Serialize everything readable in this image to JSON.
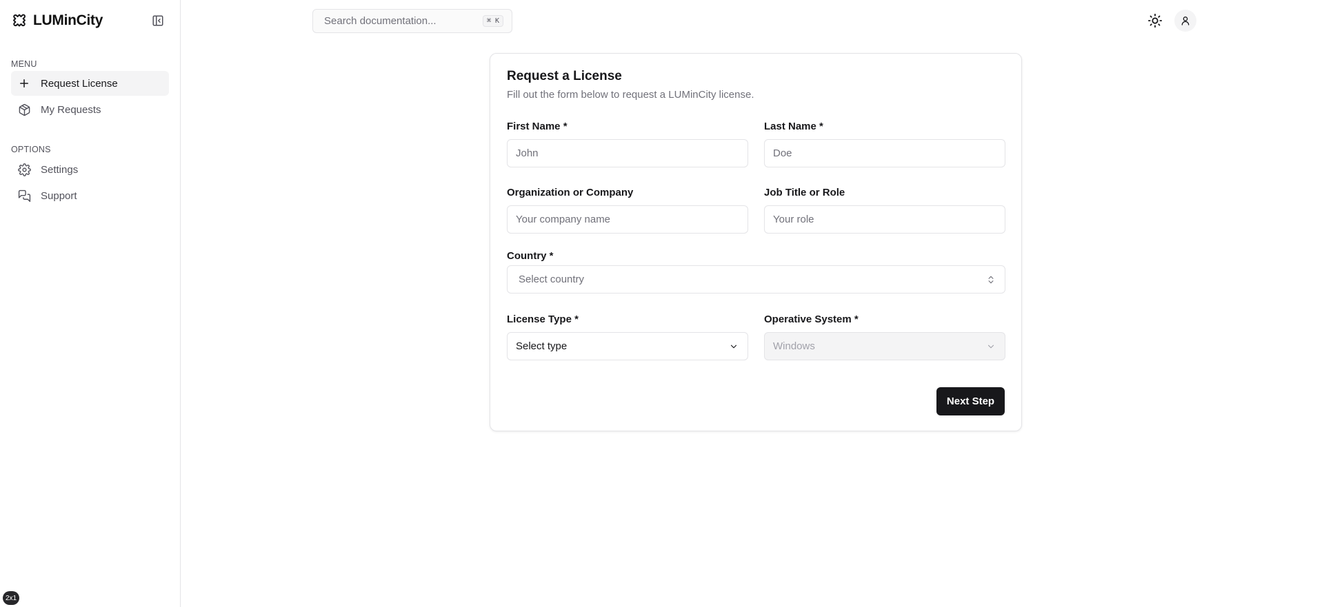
{
  "brand": {
    "name": "LUMinCity"
  },
  "sidebar": {
    "menu_label": "MENU",
    "options_label": "OPTIONS",
    "menu_items": [
      {
        "label": "Request License",
        "icon": "plus-icon",
        "active": true
      },
      {
        "label": "My Requests",
        "icon": "package-icon",
        "active": false
      }
    ],
    "option_items": [
      {
        "label": "Settings",
        "icon": "gear-icon"
      },
      {
        "label": "Support",
        "icon": "chat-bubbles-icon"
      }
    ],
    "badge": "2x1"
  },
  "header": {
    "search_placeholder": "Search documentation...",
    "search_shortcut": "⌘ K"
  },
  "form": {
    "title": "Request a License",
    "subtitle": "Fill out the form below to request a LUMinCity license.",
    "first_name": {
      "label": "First Name *",
      "placeholder": "John",
      "value": ""
    },
    "last_name": {
      "label": "Last Name *",
      "placeholder": "Doe",
      "value": ""
    },
    "organization": {
      "label": "Organization or Company",
      "placeholder": "Your company name",
      "value": ""
    },
    "job_title": {
      "label": "Job Title or Role",
      "placeholder": "Your role",
      "value": ""
    },
    "country": {
      "label": "Country *",
      "value": "Select country"
    },
    "license_type": {
      "label": "License Type *",
      "value": "Select type"
    },
    "operative_system": {
      "label": "Operative System *",
      "value": "Windows",
      "disabled": true
    },
    "next_label": "Next Step"
  },
  "colors": {
    "primary": "#18181b",
    "border": "#e4e4e7",
    "muted_text": "#71717a",
    "active_bg": "#f4f4f5"
  }
}
